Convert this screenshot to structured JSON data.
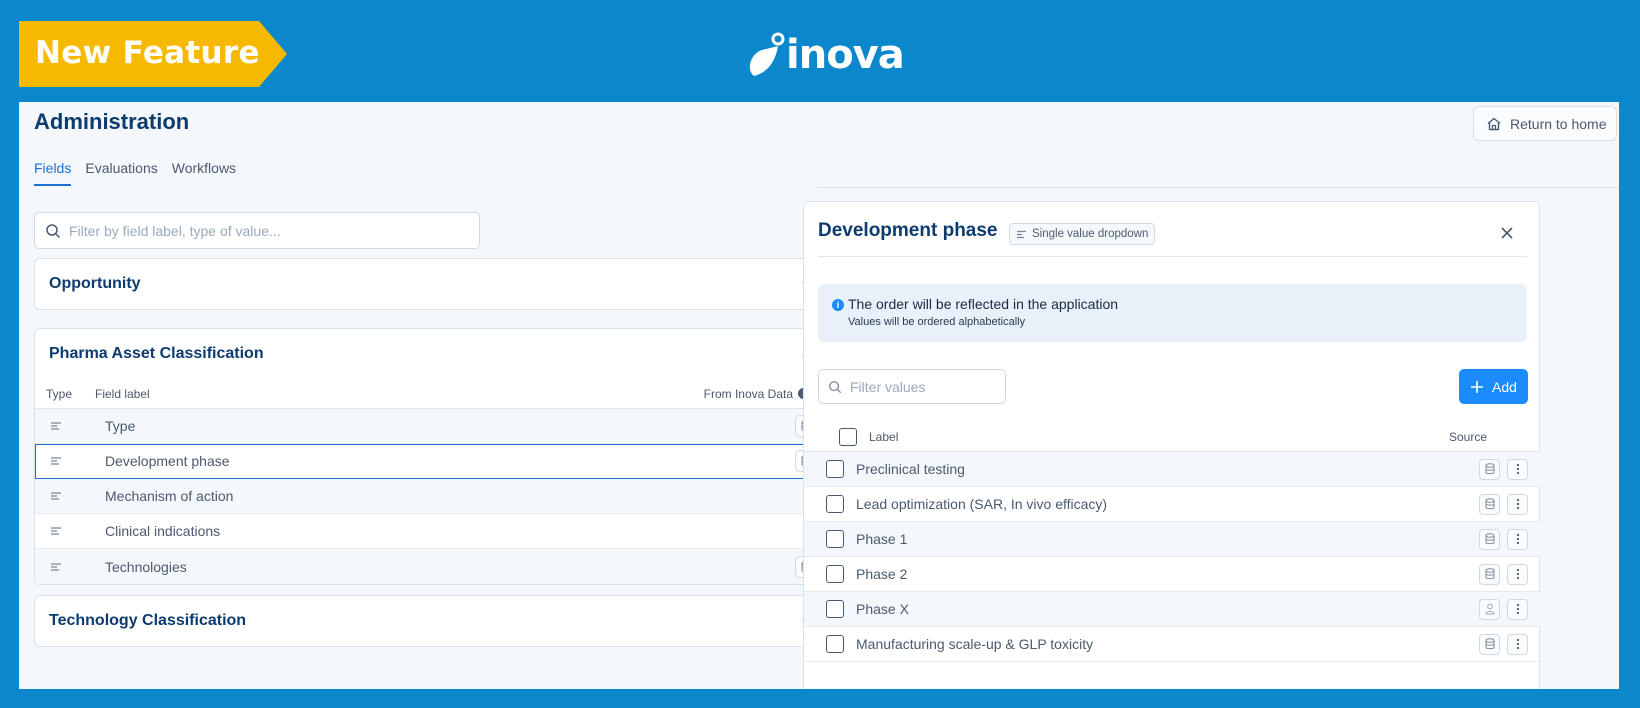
{
  "banner": {
    "label": "New Feature",
    "color": "#f7b800"
  },
  "logo": {
    "text": "inova"
  },
  "page": {
    "title": "Administration",
    "return_label": "Return to home",
    "tabs": [
      {
        "label": "Fields",
        "active": true
      },
      {
        "label": "Evaluations",
        "active": false
      },
      {
        "label": "Workflows",
        "active": false
      }
    ],
    "search_placeholder": "Filter by field label, type of value..."
  },
  "sections": [
    {
      "title": "Opportunity",
      "expanded": false
    },
    {
      "title": "Pharma Asset Classification",
      "expanded": true,
      "columns": {
        "type": "Type",
        "label": "Field label",
        "inova": "From Inova Data"
      },
      "rows": [
        {
          "label": "Type",
          "inova_data": true,
          "icon": "list-icon"
        },
        {
          "label": "Development phase",
          "inova_data": true,
          "selected": true,
          "icon": "list-icon"
        },
        {
          "label": "Mechanism of action",
          "inova_data": false,
          "icon": "list-icon"
        },
        {
          "label": "Clinical indications",
          "inova_data": false,
          "icon": "list-icon"
        },
        {
          "label": "Technologies",
          "inova_data": true,
          "icon": "list-icon"
        }
      ]
    },
    {
      "title": "Technology Classification",
      "expanded": false
    }
  ],
  "detail": {
    "title": "Development phase",
    "badge": "Single value dropdown",
    "notice": {
      "title": "The order will be reflected in the application",
      "subtitle": "Values will be ordered alphabetically"
    },
    "filter_placeholder": "Filter values",
    "add_label": "Add",
    "columns": {
      "label": "Label",
      "source": "Source"
    },
    "values": [
      {
        "label": "Preclinical testing",
        "source": "database-icon"
      },
      {
        "label": "Lead optimization (SAR, In vivo efficacy)",
        "source": "database-icon"
      },
      {
        "label": "Phase 1",
        "source": "database-icon"
      },
      {
        "label": "Phase 2",
        "source": "database-icon"
      },
      {
        "label": "Phase X",
        "source": "user-icon"
      },
      {
        "label": "Manufacturing scale-up & GLP toxicity",
        "source": "database-icon"
      }
    ]
  },
  "colors": {
    "background": "#0a88cb",
    "accent": "#1a8cff",
    "title": "#0e3b6e"
  }
}
